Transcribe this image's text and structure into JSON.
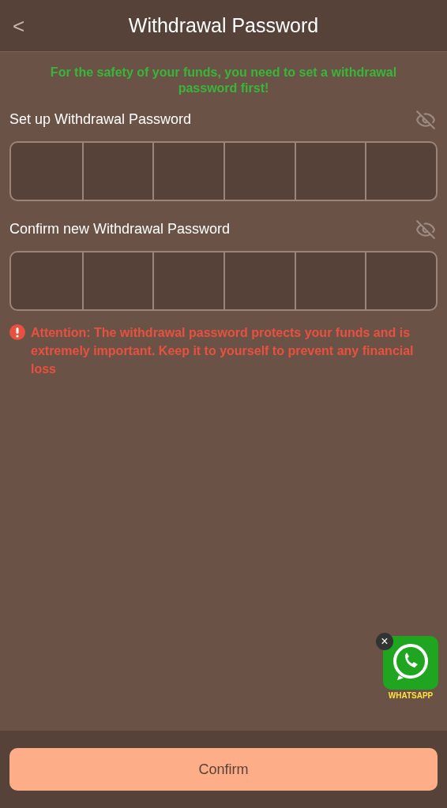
{
  "header": {
    "back": "<",
    "title": "Withdrawal Password"
  },
  "notice": "For the safety of your funds, you need to set a withdrawal password first!",
  "fields": [
    {
      "label": "Set up Withdrawal Password",
      "revealed": false
    },
    {
      "label": "Confirm new Withdrawal Password",
      "revealed": false
    }
  ],
  "warning": "Attention: The withdrawal password protects your funds and is extremely important. Keep it to yourself to prevent any financial loss",
  "chat_badge": {
    "label": "WHATSAPP",
    "close": "×"
  },
  "confirm_button": "Confirm"
}
